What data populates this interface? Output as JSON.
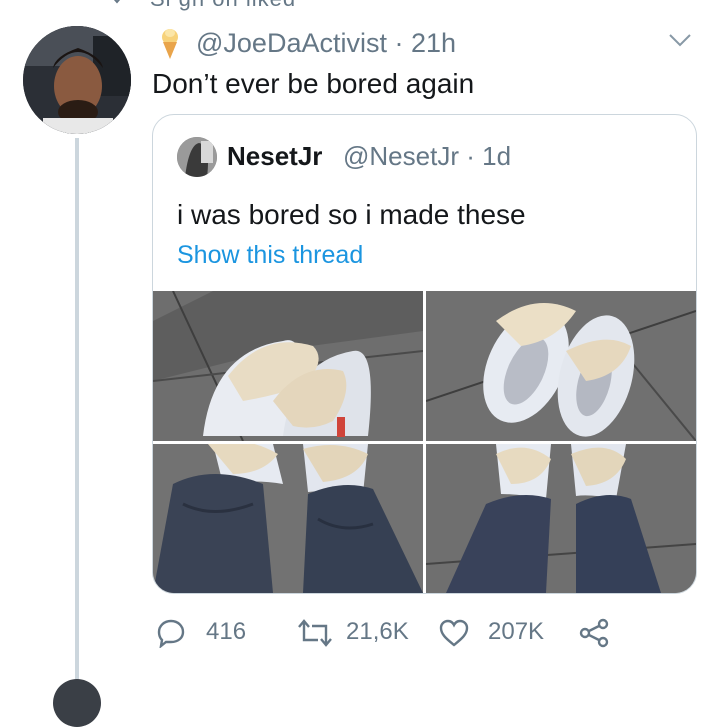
{
  "top_clip": {
    "text": "Si gh on liked",
    "icon": "heart-icon"
  },
  "tweet": {
    "avatar_icon": "user-avatar",
    "badge_emoji": "ice-cream-icon",
    "handle": "@JoeDaActivist",
    "separator": "·",
    "time": "21h",
    "text": "Don’t ever be bored again",
    "menu_icon": "chevron-down-icon"
  },
  "quote": {
    "avatar_icon": "user-avatar",
    "name": "NesetJr",
    "handle": "@NesetJr",
    "separator": "·",
    "time": "1d",
    "text": "i was bored so i made these",
    "link": "Show this thread",
    "images": [
      "sneakers-photo-1",
      "sneakers-photo-2",
      "sneakers-photo-3",
      "sneakers-photo-4"
    ]
  },
  "actions": {
    "reply_count": "416",
    "retweet_count": "21,6K",
    "like_count": "207K",
    "share_icon": "share-icon"
  },
  "colors": {
    "text": "#14171a",
    "secondary": "#657786",
    "link": "#1b95e0",
    "border": "#ccd6dd"
  }
}
